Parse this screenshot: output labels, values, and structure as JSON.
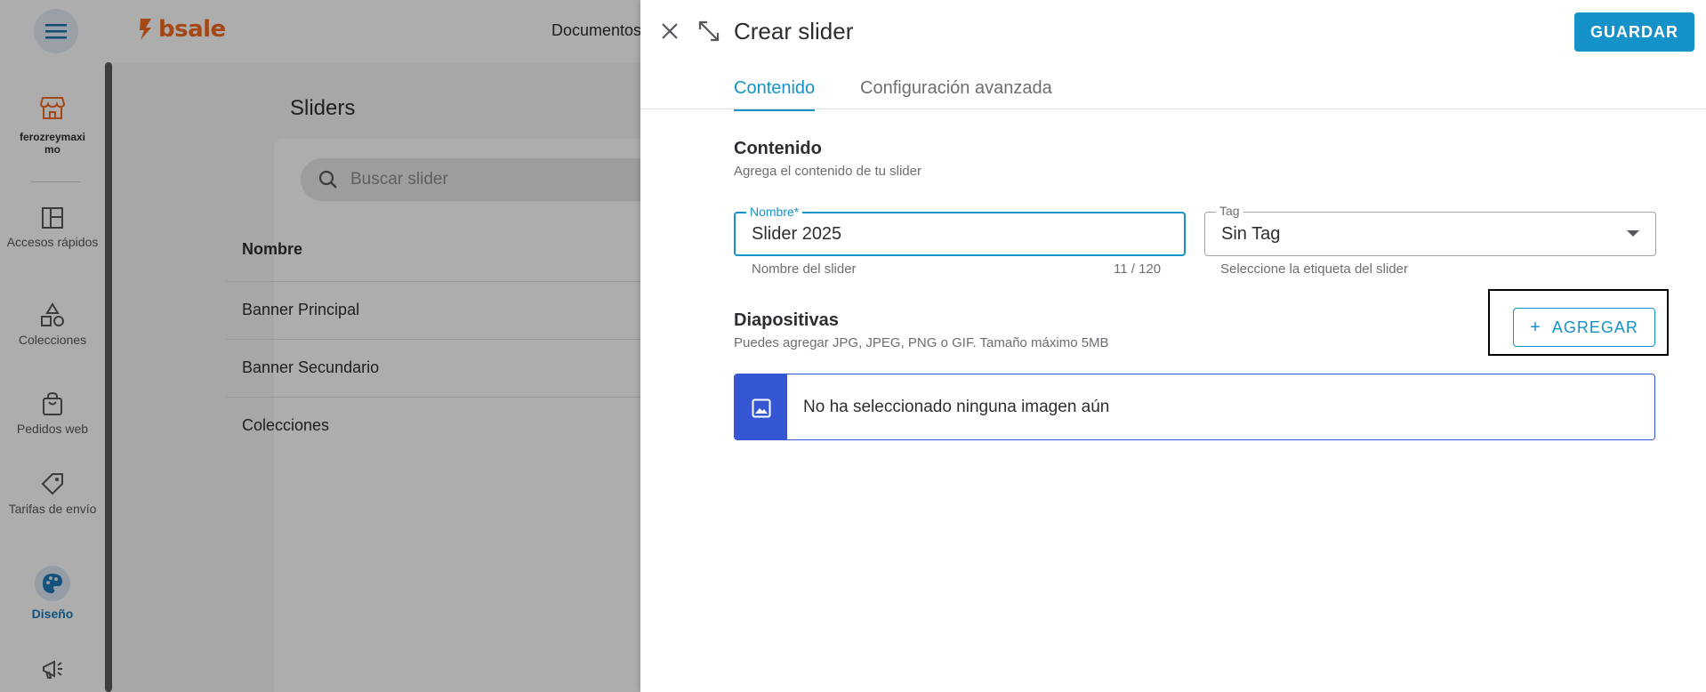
{
  "brand": {
    "logo_text": "bsale",
    "accent": "#f26a21"
  },
  "topbar": {
    "nav_item": "Documentos"
  },
  "sidebar": {
    "store_name": "ferozreymaximo",
    "items": [
      {
        "label": "Accesos rápidos",
        "icon": "layout-icon"
      },
      {
        "label": "Colecciones",
        "icon": "shapes-icon"
      },
      {
        "label": "Pedidos web",
        "icon": "shopping-bag-icon"
      },
      {
        "label": "Tarifas de envío",
        "icon": "tag-icon"
      },
      {
        "label": "Diseño",
        "icon": "palette-icon",
        "active": true
      },
      {
        "label": "",
        "icon": "megaphone-icon"
      }
    ]
  },
  "main": {
    "page_title": "Sliders",
    "search_placeholder": "Buscar slider",
    "column_header": "Nombre",
    "rows": [
      "Banner Principal",
      "Banner Secundario",
      "Colecciones"
    ]
  },
  "drawer": {
    "title": "Crear slider",
    "save_label": "GUARDAR",
    "tabs": [
      "Contenido",
      "Configuración avanzada"
    ],
    "content": {
      "title": "Contenido",
      "subtitle": "Agrega el contenido de tu slider",
      "name_field": {
        "label": "Nombre*",
        "value": "Slider 2025",
        "helper": "Nombre del slider",
        "counter": "11 / 120"
      },
      "tag_field": {
        "label": "Tag",
        "value": "Sin Tag",
        "helper": "Seleccione la etiqueta del slider"
      }
    },
    "slides": {
      "title": "Diapositivas",
      "subtitle": "Puedes agregar JPG, JPEG, PNG o GIF. Tamaño máximo 5MB",
      "add_label": "AGREGAR",
      "empty_text": "No ha seleccionado ninguna imagen aún"
    }
  },
  "colors": {
    "primary": "#1592c9",
    "info": "#3557d3",
    "text": "#2b2f33"
  }
}
